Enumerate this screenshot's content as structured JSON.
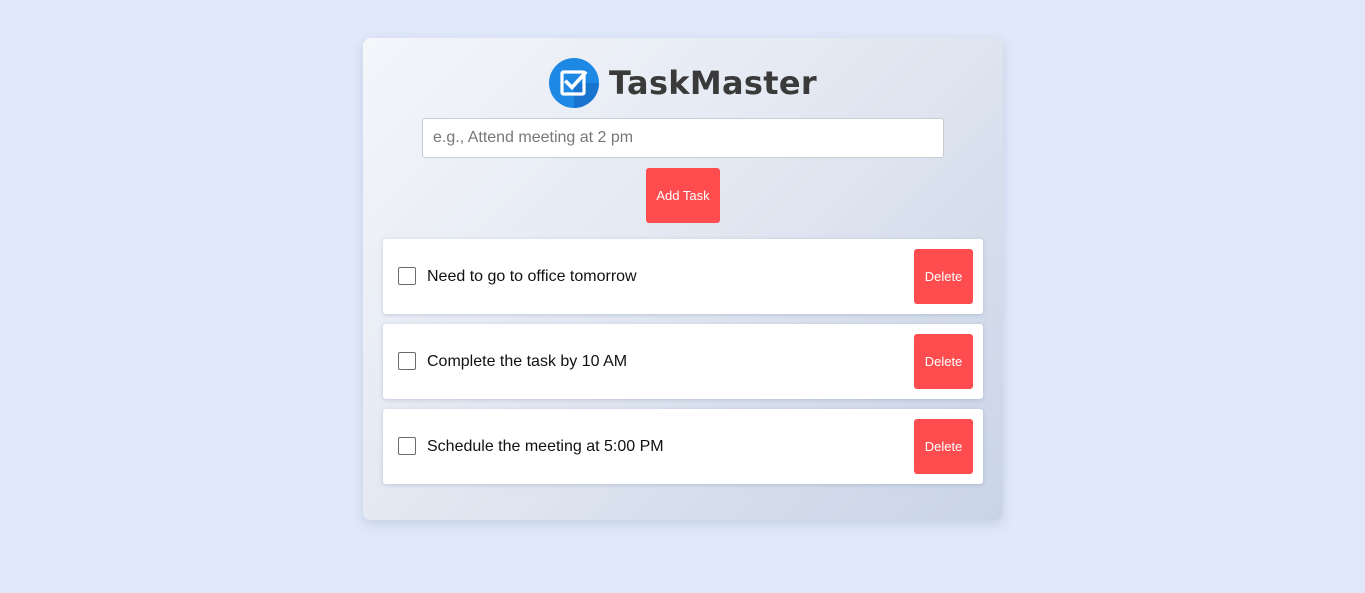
{
  "app": {
    "title": "TaskMaster",
    "logo_icon": "checkbox-check-icon",
    "accent_color": "#ff4d4f",
    "logo_color": "#1e88e5"
  },
  "input": {
    "placeholder": "e.g., Attend meeting at 2 pm",
    "value": ""
  },
  "add_button": {
    "label": "Add Task"
  },
  "tasks": [
    {
      "text": "Need to go to office tomorrow",
      "checked": false,
      "delete_label": "Delete"
    },
    {
      "text": "Complete the task by 10 AM",
      "checked": false,
      "delete_label": "Delete"
    },
    {
      "text": "Schedule the meeting at 5:00 PM",
      "checked": false,
      "delete_label": "Delete"
    }
  ]
}
